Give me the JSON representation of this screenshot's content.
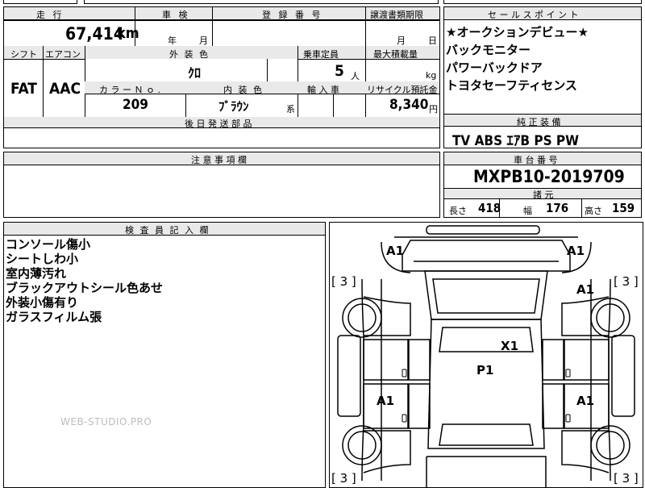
{
  "top_strip": {
    "partial_text": "日帰 検"
  },
  "row1": {
    "mileage_label": "走 行",
    "mileage_value": "67,414",
    "mileage_unit": "km",
    "inspection_label": "車 検",
    "inspection_year_unit": "年",
    "inspection_month_unit": "月",
    "registration_label": "登 録 番 号",
    "registration_value": "",
    "transfer_label": "譲渡書類期限",
    "transfer_month_unit": "月",
    "transfer_day_unit": "日"
  },
  "row2": {
    "shift_label": "シフト",
    "shift_value": "FAT",
    "aircon_label": "エアコン",
    "aircon_value": "AAC",
    "exterior_color_label": "外 装 色",
    "exterior_color_value": "ｸﾛ",
    "color_no_label": "カ ラ ー Ｎ ｏ .",
    "color_no_value": "209",
    "interior_color_label": "内 装 色",
    "interior_color_value": "ﾌﾞﾗｳﾝ",
    "interior_suffix": "系",
    "capacity_label": "乗車定員",
    "capacity_value": "5",
    "capacity_unit": "人",
    "max_load_label": "最大積載量",
    "max_load_unit": "kg",
    "import_label": "輸 入 車",
    "recycle_label": "リサイクル預託金",
    "recycle_value": "8,340",
    "recycle_unit": "円"
  },
  "later_parts": {
    "label": "後 日 発 送 部 品"
  },
  "sales_points": {
    "label": "セ ー ル ス ポ イ ン ト",
    "items": [
      "★オークションデビュー★",
      "バックモニター",
      "パワーバックドア",
      "トヨタセーフティセンス"
    ]
  },
  "equipment": {
    "label": "純 正 装 備",
    "value": "TV  ABS  ｴｱB  PS  PW"
  },
  "notes": {
    "label": "注 意 事 項 欄"
  },
  "chassis": {
    "label": "車 台 番 号",
    "value": "MXPB10-2019709"
  },
  "specs": {
    "label": "諸 元",
    "length_label": "長さ",
    "length_value": "418",
    "width_label": "幅",
    "width_value": "176",
    "height_label": "高さ",
    "height_value": "159"
  },
  "inspector": {
    "label": "検 査 員 記 入 欄",
    "lines": [
      "コンソール傷小",
      "シートしわ小",
      "室内薄汚れ",
      "ブラックアウトシール色あせ",
      "外装小傷有り",
      "ガラスフィルム張"
    ]
  },
  "watermark": "WEB-STUDIO.PRO",
  "diagram": {
    "marks": {
      "front_left": "A1",
      "front_right": "A1",
      "right_front_fender": "A1",
      "roof": "X1",
      "center": "P1",
      "left_door": "A1",
      "right_door": "A1"
    },
    "tire_fl": "[ 3 ]",
    "tire_fr": "[ 3 ]",
    "tire_rl": "[ 3 ]",
    "tire_rr": "[ 3 ]"
  }
}
